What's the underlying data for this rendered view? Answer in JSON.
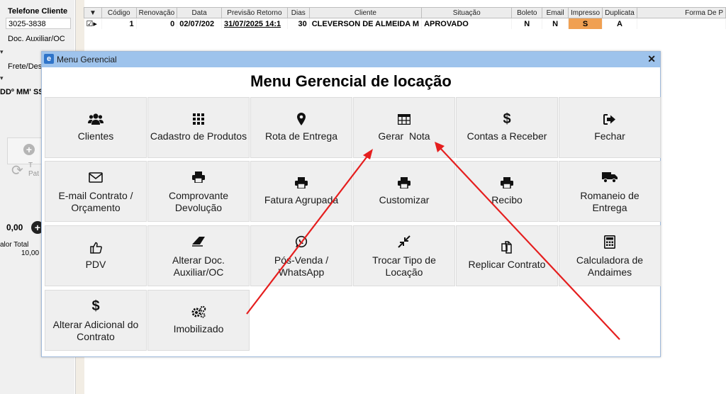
{
  "left_panel": {
    "telefone_label": "Telefone Cliente",
    "telefone_value": "3025-3838",
    "doc_label": "Doc. Auxiliar/OC",
    "frete_label": "Frete/Des",
    "cod_text": "DDº MM' SS",
    "side_btn_text1": "T",
    "side_btn_text2": "Pat",
    "amount": "0,00",
    "valor_total_label": "alor Total",
    "valor_total_value": "10,00"
  },
  "grid": {
    "columns": [
      "▼",
      "Código",
      "Renovação",
      "Data",
      "Previsão Retorno",
      "Dias",
      "Cliente",
      "Situação",
      "Boleto",
      "Email",
      "Impresso",
      "Duplicata",
      "Forma De P"
    ],
    "row": {
      "marker": "☑▸",
      "codigo": "1",
      "renovacao": "0",
      "data": "02/07/202",
      "previsao": "31/07/2025 14:1",
      "dias": "30",
      "cliente": "CLEVERSON DE ALMEIDA M",
      "situacao": "APROVADO",
      "boleto": "N",
      "email": "N",
      "impresso": "S",
      "duplicata": "A"
    }
  },
  "dialog": {
    "window_icon": "e",
    "title": "Menu Gerencial",
    "close_label": "✕",
    "heading": "Menu Gerencial de locação",
    "tiles": [
      {
        "icon": "users-icon",
        "label": "Clientes"
      },
      {
        "icon": "grid-icon",
        "label": "Cadastro de Produtos"
      },
      {
        "icon": "map-marker-icon",
        "label": "Rota de Entrega"
      },
      {
        "icon": "table-icon",
        "label": "Gerar  Nota"
      },
      {
        "icon": "dollar-icon",
        "label": "Contas a Receber"
      },
      {
        "icon": "sign-out-icon",
        "label": "Fechar"
      },
      {
        "icon": "envelope-icon",
        "label": "E-mail Contrato / Orçamento"
      },
      {
        "icon": "print-icon",
        "label": "Comprovante Devolução"
      },
      {
        "icon": "print-icon",
        "label": "Fatura Agrupada"
      },
      {
        "icon": "print-icon",
        "label": "Customizar"
      },
      {
        "icon": "print-icon",
        "label": "Recibo"
      },
      {
        "icon": "truck-icon",
        "label": "Romaneio de Entrega"
      },
      {
        "icon": "thumbs-up-icon",
        "label": "PDV"
      },
      {
        "icon": "eraser-icon",
        "label": "Alterar Doc. Auxiliar/OC"
      },
      {
        "icon": "whatsapp-icon",
        "label": "Pós-Venda / WhatsApp"
      },
      {
        "icon": "compress-icon",
        "label": "Trocar Tipo de Locação"
      },
      {
        "icon": "copy-icon",
        "label": "Replicar Contrato"
      },
      {
        "icon": "calculator-icon",
        "label": "Calculadora de Andaimes"
      },
      {
        "icon": "dollar-icon",
        "label": "Alterar Adicional do Contrato"
      },
      {
        "icon": "cogs-icon",
        "label": "Imobilizado"
      }
    ]
  },
  "colors": {
    "titlebar": "#9ec3ec",
    "annotation_arrow": "#e51e1e",
    "impresso_cell": "#f0a052"
  }
}
